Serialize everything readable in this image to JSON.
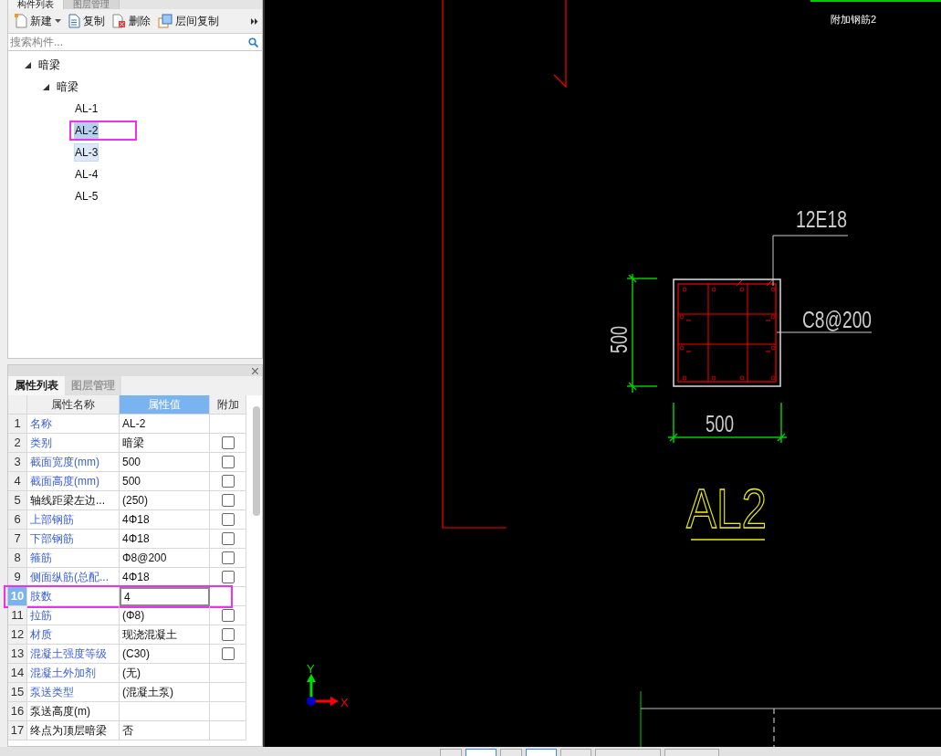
{
  "component_panel": {
    "tabs": [
      {
        "label": "构件列表",
        "selected": true
      },
      {
        "label": "图层管理",
        "selected": false
      }
    ],
    "toolbar": [
      {
        "kind": "new",
        "label": "新建",
        "dropdown": true
      },
      {
        "kind": "copy",
        "label": "复制",
        "dropdown": false
      },
      {
        "kind": "delete",
        "label": "删除",
        "dropdown": false
      },
      {
        "kind": "floor-copy",
        "label": "层间复制",
        "dropdown": false
      }
    ],
    "search": {
      "placeholder": "搜索构件..."
    },
    "tree": [
      {
        "label": "暗梁",
        "expanded": true,
        "children": [
          {
            "label": "暗梁",
            "expanded": true,
            "children": [
              {
                "label": "AL-1",
                "selected": false,
                "highlighted": false,
                "marked": false
              },
              {
                "label": "AL-2",
                "selected": true,
                "highlighted": false,
                "marked": true
              },
              {
                "label": "AL-3",
                "selected": false,
                "highlighted": true,
                "marked": false
              },
              {
                "label": "AL-4",
                "selected": false,
                "highlighted": false,
                "marked": false
              },
              {
                "label": "AL-5",
                "selected": false,
                "highlighted": false,
                "marked": false
              }
            ]
          }
        ]
      }
    ]
  },
  "property_panel": {
    "tabs": [
      {
        "label": "属性列表",
        "selected": true
      },
      {
        "label": "图层管理",
        "selected": false
      }
    ],
    "columns": [
      {
        "label": "属性名称",
        "selected": false
      },
      {
        "label": "属性值",
        "selected": true
      },
      {
        "label": "附加",
        "selected": false
      }
    ],
    "rows": [
      {
        "number": "1",
        "name": "名称",
        "value": "AL-2",
        "public": true,
        "kind": "plain",
        "selected": false,
        "marked": false
      },
      {
        "number": "2",
        "name": "类别",
        "value": "暗梁",
        "public": true,
        "kind": "checkbox",
        "checked": false,
        "selected": false,
        "marked": false
      },
      {
        "number": "3",
        "name": "截面宽度(mm)",
        "value": "500",
        "public": true,
        "kind": "checkbox",
        "checked": false,
        "selected": false,
        "marked": false
      },
      {
        "number": "4",
        "name": "截面高度(mm)",
        "value": "500",
        "public": true,
        "kind": "checkbox",
        "checked": false,
        "selected": false,
        "marked": false
      },
      {
        "number": "5",
        "name": "轴线距梁左边...",
        "value": "(250)",
        "public": false,
        "kind": "checkbox",
        "checked": false,
        "selected": false,
        "marked": false
      },
      {
        "number": "6",
        "name": "上部钢筋",
        "value": "4Φ18",
        "public": true,
        "kind": "checkbox",
        "checked": false,
        "selected": false,
        "marked": false
      },
      {
        "number": "7",
        "name": "下部钢筋",
        "value": "4Φ18",
        "public": true,
        "kind": "checkbox",
        "checked": false,
        "selected": false,
        "marked": false
      },
      {
        "number": "8",
        "name": "箍筋",
        "value": "Φ8@200",
        "public": true,
        "kind": "checkbox",
        "checked": false,
        "selected": false,
        "marked": false
      },
      {
        "number": "9",
        "name": "侧面纵筋(总配...",
        "value": "4Φ18",
        "public": true,
        "kind": "checkbox",
        "checked": false,
        "selected": false,
        "marked": false
      },
      {
        "number": "10",
        "name": "肢数",
        "value": "4",
        "public": true,
        "kind": "plain",
        "selected": true,
        "marked": true
      },
      {
        "number": "11",
        "name": "拉筋",
        "value": "(Φ8)",
        "public": true,
        "kind": "checkbox",
        "checked": false,
        "selected": false,
        "marked": false
      },
      {
        "number": "12",
        "name": "材质",
        "value": "现浇混凝土",
        "public": true,
        "kind": "checkbox",
        "checked": false,
        "selected": false,
        "marked": false
      },
      {
        "number": "13",
        "name": "混凝土强度等级",
        "value": "(C30)",
        "public": true,
        "kind": "checkbox",
        "checked": false,
        "selected": false,
        "marked": false
      },
      {
        "number": "14",
        "name": "混凝土外加剂",
        "value": "(无)",
        "public": true,
        "kind": "plain",
        "selected": false,
        "marked": false
      },
      {
        "number": "15",
        "name": "泵送类型",
        "value": "(混凝土泵)",
        "public": true,
        "kind": "plain",
        "selected": false,
        "marked": false
      },
      {
        "number": "16",
        "name": "泵送高度(m)",
        "public": false,
        "kind": "plain",
        "selected": false,
        "marked": false
      },
      {
        "number": "17",
        "name": "终点为顶层暗梁",
        "value": "否",
        "public": false,
        "kind": "plain",
        "selected": false,
        "marked": false
      }
    ]
  },
  "canvas": {
    "top_label": "附加钢筋2",
    "bar_callout": "12E18",
    "stirrup_callout": "C8@200",
    "height_dimension": "500",
    "width_dimension": "500",
    "section_name": "AL2",
    "axis_y": "Y",
    "axis_x": "X"
  }
}
